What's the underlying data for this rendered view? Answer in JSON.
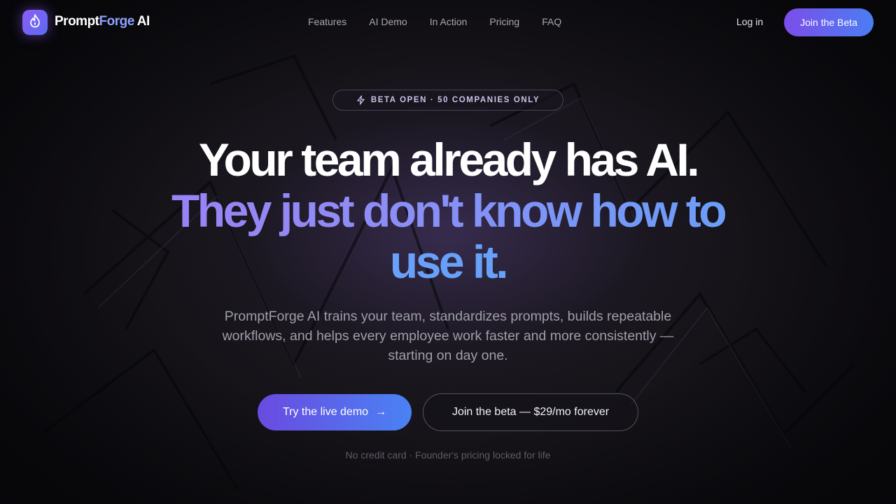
{
  "brand": {
    "part1": "Prompt",
    "part2": "Forge",
    "part3": "AI",
    "icon": "flame-icon"
  },
  "nav": {
    "links": [
      "Features",
      "AI Demo",
      "In Action",
      "Pricing",
      "FAQ"
    ],
    "login_label": "Log in",
    "cta_label": "Join the Beta"
  },
  "hero": {
    "badge": "BETA OPEN · 50 COMPANIES ONLY",
    "badge_icon": "lightning-icon",
    "headline_line1": "Your team already has AI.",
    "headline_line2": "They just don't know how to",
    "headline_line3": "use it.",
    "subtitle": "PromptForge AI trains your team, standardizes prompts, builds repeatable workflows, and helps every employee work faster and more consistently — starting on day one.",
    "primary_cta": "Try the live demo",
    "primary_cta_icon": "arrow-right-icon",
    "secondary_cta": "Join the beta — $29/mo forever",
    "fine_print": "No credit card · Founder's pricing locked for life"
  },
  "colors": {
    "accent_purple": "#8b5cf6",
    "accent_blue": "#4a82f4",
    "background": "#0d0c10"
  }
}
